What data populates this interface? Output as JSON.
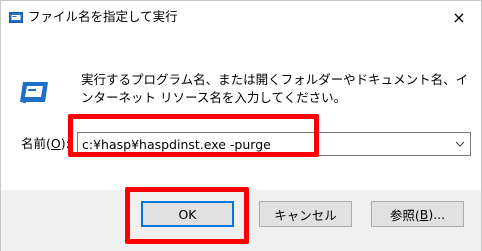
{
  "window": {
    "title": "ファイル名を指定して実行",
    "close_glyph": "×"
  },
  "content": {
    "description": "実行するプログラム名、または開くフォルダーやドキュメント名、インターネット リソース名を入力してください。",
    "name_label_prefix": "名前(",
    "name_label_accel": "O",
    "name_label_suffix": "):",
    "command_value": "c:¥hasp¥haspdinst.exe -purge"
  },
  "buttons": {
    "ok": "OK",
    "cancel": "キャンセル",
    "browse_prefix": "参照(",
    "browse_accel": "B",
    "browse_suffix": ")..."
  },
  "colors": {
    "highlight": "#ff0000",
    "focus_border": "#0078d7",
    "footer_bg": "#f0f0f0",
    "icon_blue": "#1e6fc8"
  }
}
